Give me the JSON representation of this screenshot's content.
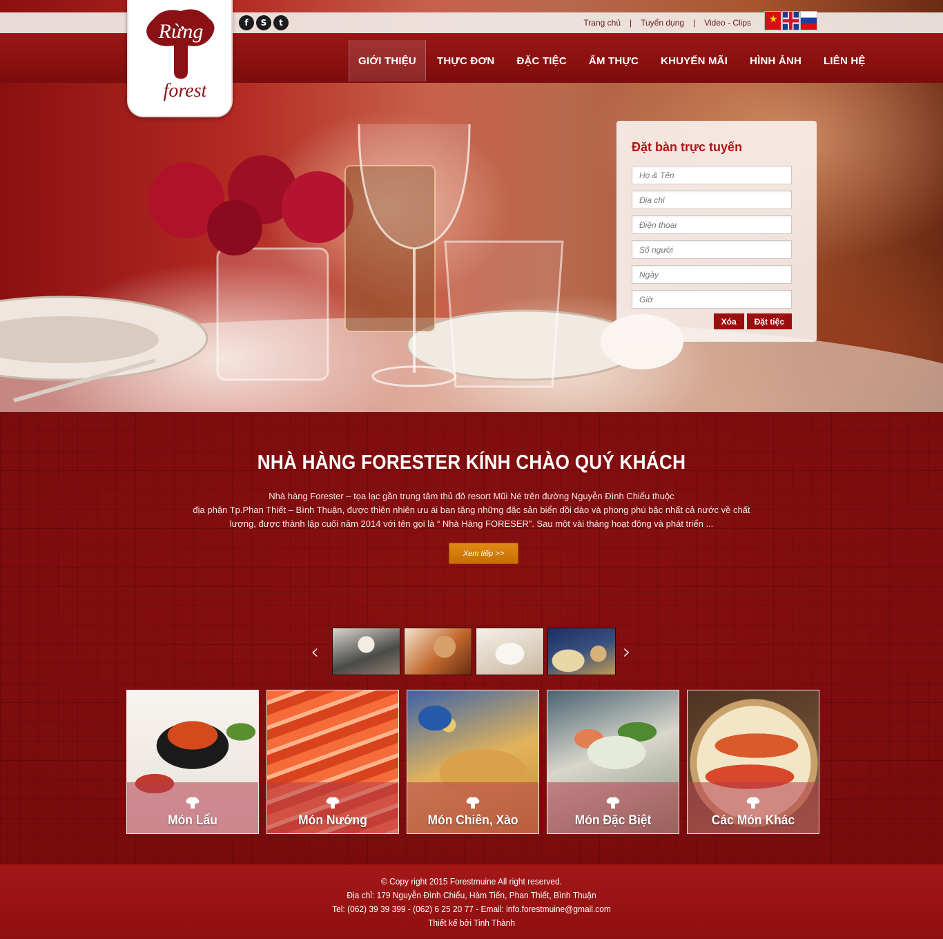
{
  "brand": {
    "logo_text_top": "Rừng",
    "logo_text_bottom": "forest"
  },
  "social": [
    {
      "icon": "facebook-icon",
      "glyph": "f"
    },
    {
      "icon": "skype-icon",
      "glyph": "S"
    },
    {
      "icon": "twitter-icon",
      "glyph": "t"
    }
  ],
  "top_links": {
    "home": "Trang chủ",
    "jobs": "Tuyển dụng",
    "video": "Video - Clips",
    "separator": "|"
  },
  "languages": [
    "vietnamese-flag-icon",
    "english-flag-icon",
    "russian-flag-icon"
  ],
  "nav": {
    "items": [
      "GIỚI THIỆU",
      "THỰC ĐƠN",
      "ĐẶC TIỆC",
      "ẨM THỰC",
      "KHUYẾN MÃI",
      "HÌNH ẢNH",
      "LIÊN HỆ"
    ],
    "active_index": 0
  },
  "booking": {
    "title": "Đặt bàn trực tuyến",
    "fields": {
      "name": "Họ & Tên",
      "address": "Địa chỉ",
      "phone": "Điện thoại",
      "people": "Số người",
      "date": "Ngày",
      "time": "Giờ"
    },
    "clear_label": "Xóa",
    "submit_label": "Đặt tiệc"
  },
  "welcome": {
    "title": "NHÀ HÀNG FORESTER KÍNH CHÀO QUÝ KHÁCH",
    "line1": "Nhà hàng Forester – tọa lạc gần trung tâm thủ đô resort Mũi Né trên đường Nguyễn Đình Chiểu thuộc",
    "line2": "địa phận Tp.Phan Thiết – Bình Thuận, được thiên nhiên ưu ái ban tặng những đặc sản biển dồi dào và phong phú bậc nhất cả nước về chất",
    "line3": "lượng, được thành lập cuối năm 2014 với tên gọi là “ Nhà Hàng FORESER”. Sau một vài tháng hoạt động và phát triển ...",
    "more_label": "Xem tiếp >>"
  },
  "slider": {
    "prev": "‹",
    "next": "›"
  },
  "categories": [
    "Món Lẩu",
    "Món Nướng",
    "Món Chiên, Xào",
    "Món Đặc Biệt",
    "Các Món Khác"
  ],
  "footer": {
    "copyright": "© Copy right 2015 Forestmuine All right reserved.",
    "address": "Địa chỉ: 179 Nguyễn Đình Chiểu, Hàm Tiến, Phan Thiết, Bình Thuận",
    "contact": "Tel: (062) 39 39 399 - (062) 6 25 20 77  -  Email: info.forestmuine@gmail.com",
    "designer": "Thiết kế bởi Tinh Thành"
  },
  "colors": {
    "primary": "#9c0d0d",
    "accent_button": "#d97d0c",
    "background": "#7a0b0d"
  }
}
